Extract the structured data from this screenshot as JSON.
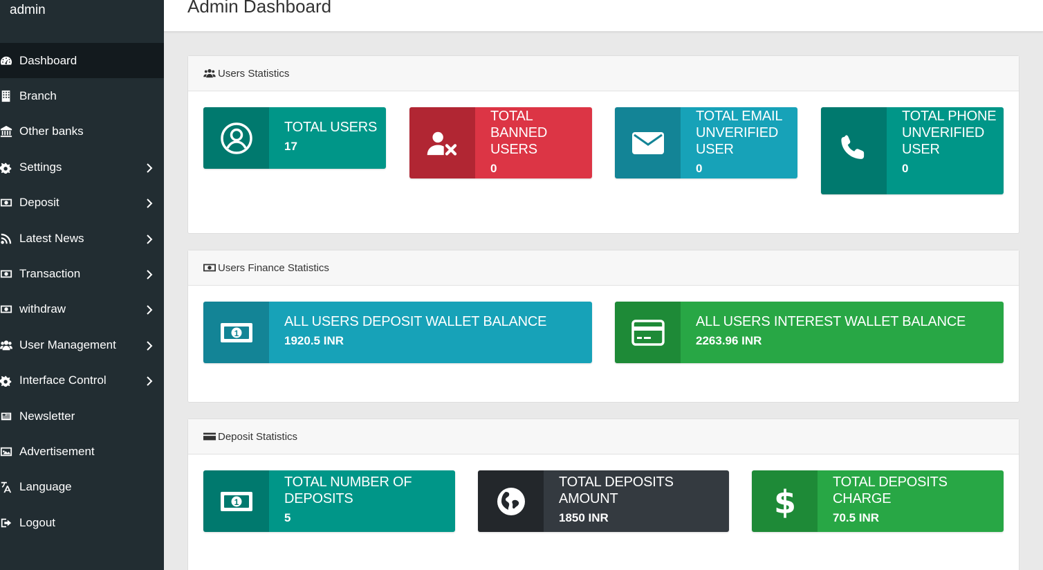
{
  "brand": "admin",
  "header": {
    "title": "Admin Dashboard"
  },
  "sidebar": {
    "items": [
      {
        "label": "Dashboard",
        "icon": "dashboard-icon",
        "active": true,
        "has_submenu": false
      },
      {
        "label": "Branch",
        "icon": "building-icon",
        "active": false,
        "has_submenu": false
      },
      {
        "label": "Other banks",
        "icon": "bank-icon",
        "active": false,
        "has_submenu": false
      },
      {
        "label": "Settings",
        "icon": "gears-icon",
        "active": false,
        "has_submenu": true
      },
      {
        "label": "Deposit",
        "icon": "money-icon",
        "active": false,
        "has_submenu": true
      },
      {
        "label": "Latest News",
        "icon": "rss-icon",
        "active": false,
        "has_submenu": true
      },
      {
        "label": "Transaction",
        "icon": "money-icon",
        "active": false,
        "has_submenu": true
      },
      {
        "label": "withdraw",
        "icon": "money-icon",
        "active": false,
        "has_submenu": true
      },
      {
        "label": "User Management",
        "icon": "users-icon",
        "active": false,
        "has_submenu": true
      },
      {
        "label": "Interface Control",
        "icon": "gears-icon",
        "active": false,
        "has_submenu": true
      },
      {
        "label": "Newsletter",
        "icon": "newspaper-icon",
        "active": false,
        "has_submenu": false
      },
      {
        "label": "Advertisement",
        "icon": "image-icon",
        "active": false,
        "has_submenu": false
      },
      {
        "label": "Language",
        "icon": "language-icon",
        "active": false,
        "has_submenu": false
      },
      {
        "label": "Logout",
        "icon": "sign-out-icon",
        "active": false,
        "has_submenu": false
      }
    ]
  },
  "users_stats": {
    "heading": "Users Statistics",
    "cards": [
      {
        "title": "TOTAL USERS",
        "value": "17",
        "icon": "user-circle-icon",
        "color": "teal"
      },
      {
        "title": "TOTAL BANNED USERS",
        "value": "0",
        "icon": "user-times-icon",
        "color": "red"
      },
      {
        "title": "TOTAL EMAIL UNVERIFIED USER",
        "value": "0",
        "icon": "envelope-icon",
        "color": "cyan"
      },
      {
        "title": "TOTAL PHONE UNVERIFIED USER",
        "value": "0",
        "icon": "phone-icon",
        "color": "teal"
      }
    ]
  },
  "finance_stats": {
    "heading": "Users Finance Statistics",
    "cards": [
      {
        "title": "ALL USERS DEPOSIT WALLET BALANCE",
        "value": "1920.5 INR",
        "icon": "money-bill-icon",
        "color": "cyan"
      },
      {
        "title": "ALL USERS INTEREST WALLET BALANCE",
        "value": "2263.96 INR",
        "icon": "credit-card-icon",
        "color": "green"
      }
    ]
  },
  "deposit_stats": {
    "heading": "Deposit Statistics",
    "cards": [
      {
        "title": "TOTAL NUMBER OF DEPOSITS",
        "value": "5",
        "icon": "money-bill-icon",
        "color": "teal"
      },
      {
        "title": "TOTAL DEPOSITS AMOUNT",
        "value": "1850 INR",
        "icon": "globe-icon",
        "color": "dark"
      },
      {
        "title": "TOTAL DEPOSITS CHARGE",
        "value": "70.5 INR",
        "icon": "dollar-icon",
        "color": "green"
      }
    ]
  },
  "colors": {
    "sidebar_bg": "#222d32",
    "teal": "#009688",
    "red": "#dc3545",
    "cyan": "#17a2b8",
    "green": "#28a745",
    "dark": "#343a40"
  }
}
